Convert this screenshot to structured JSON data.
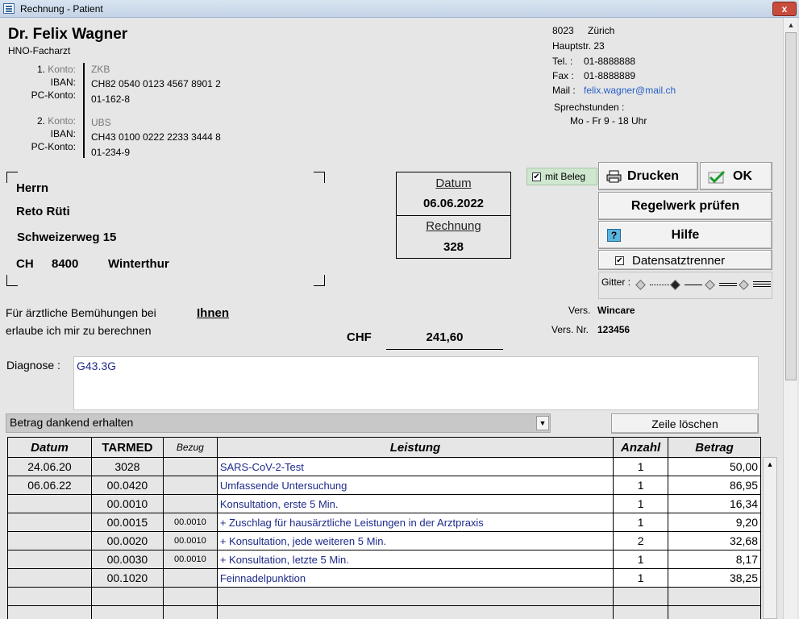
{
  "window": {
    "title": "Rechnung - Patient",
    "close_label": "x"
  },
  "doctor": {
    "name": "Dr. Felix Wagner",
    "specialty": "HNO-Facharzt",
    "accounts": [
      {
        "num_label": "1.",
        "konto_label": "Konto:",
        "iban_label": "IBAN:",
        "pc_label": "PC-Konto:",
        "bank": "ZKB",
        "iban": "CH82 0540 0123 4567 8901 2",
        "pc": "01-162-8"
      },
      {
        "num_label": "2.",
        "konto_label": "Konto:",
        "iban_label": "IBAN:",
        "pc_label": "PC-Konto:",
        "bank": "UBS",
        "iban": "CH43 0100 0222 2233 3444 8",
        "pc": "01-234-9"
      }
    ],
    "address": {
      "zip": "8023",
      "city": "Zürich",
      "street": "Hauptstr. 23",
      "tel_label": "Tel. :",
      "tel": "01-8888888",
      "fax_label": "Fax :",
      "fax": "01-8888889",
      "mail_label": "Mail :",
      "mail": "felix.wagner@mail.ch",
      "hours_label": "Sprechstunden :",
      "hours": "Mo - Fr 9 - 18 Uhr"
    }
  },
  "recipient": {
    "salutation": "Herrn",
    "name": "Reto Rüti",
    "street": "Schweizerweg 15",
    "country": "CH",
    "zip": "8400",
    "city": "Winterthur"
  },
  "invoice": {
    "date_label": "Datum",
    "date": "06.06.2022",
    "number_label": "Rechnung",
    "number": "328"
  },
  "actions": {
    "mit_beleg": "mit Beleg",
    "mit_beleg_checked": true,
    "print": "Drucken",
    "ok": "OK",
    "check_rules": "Regelwerk prüfen",
    "help": "Hilfe",
    "help_glyph": "?",
    "separator": "Datensatztrenner",
    "separator_checked": true,
    "grid_label": "Gitter :"
  },
  "billing": {
    "line1": "Für ärztliche Bemühungen bei",
    "line2": "erlaube ich mir zu berechnen",
    "addressee": "Ihnen",
    "currency": "CHF",
    "total": "241,60",
    "insurer_label": "Vers.",
    "insurer": "Wincare",
    "insurer_no_label": "Vers. Nr.",
    "insurer_no": "123456"
  },
  "diagnosis": {
    "label": "Diagnose :",
    "value": "G43.3G"
  },
  "status": {
    "value": "Betrag dankend erhalten"
  },
  "delete_row": "Zeile löschen",
  "table": {
    "headers": {
      "date": "Datum",
      "tarmed": "TARMED",
      "ref": "Bezug",
      "service": "Leistung",
      "qty": "Anzahl",
      "amount": "Betrag"
    },
    "rows": [
      {
        "date": "24.06.20",
        "code": "3028",
        "ref": "",
        "service": "SARS-CoV-2-Test",
        "qty": "1",
        "amount": "50,00"
      },
      {
        "date": "06.06.22",
        "code": "00.0420",
        "ref": "",
        "service": "Umfassende Untersuchung",
        "qty": "1",
        "amount": "86,95"
      },
      {
        "date": "",
        "code": "00.0010",
        "ref": "",
        "service": "Konsultation, erste 5 Min.",
        "qty": "1",
        "amount": "16,34"
      },
      {
        "date": "",
        "code": "00.0015",
        "ref": "00.0010",
        "service": "+ Zuschlag für hausärztliche Leistungen in der Arztpraxis",
        "qty": "1",
        "amount": "9,20"
      },
      {
        "date": "",
        "code": "00.0020",
        "ref": "00.0010",
        "service": "+ Konsultation, jede weiteren 5 Min.",
        "qty": "2",
        "amount": "32,68"
      },
      {
        "date": "",
        "code": "00.0030",
        "ref": "00.0010",
        "service": "+ Konsultation, letzte 5 Min.",
        "qty": "1",
        "amount": "8,17"
      },
      {
        "date": "",
        "code": "00.1020",
        "ref": "",
        "service": "Feinnadelpunktion",
        "qty": "1",
        "amount": "38,25"
      }
    ]
  }
}
